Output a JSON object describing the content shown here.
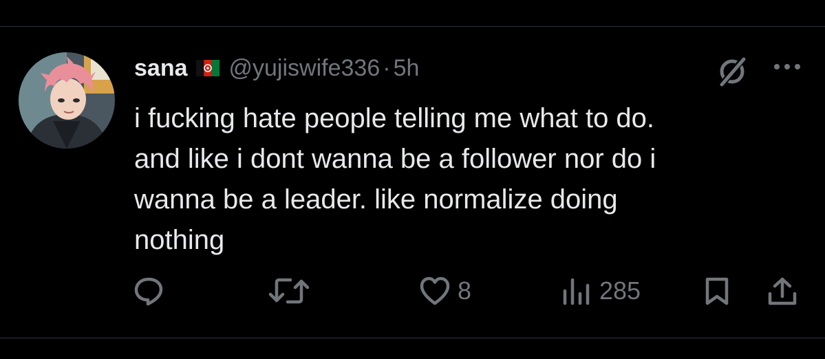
{
  "tweet": {
    "display_name": "sana",
    "handle": "@yujiswife336",
    "separator": "·",
    "time": "5h",
    "text": "i fucking hate people telling me what to do.\nand like i dont wanna be a follower nor do i\nwanna be a leader. like normalize doing\nnothing",
    "flag_icon": "afghanistan-flag-emoji",
    "avatar": "anime-character-pink-hair-avatar"
  },
  "actions": {
    "reply": {
      "icon": "reply-icon",
      "count": ""
    },
    "retweet": {
      "icon": "retweet-icon",
      "count": ""
    },
    "like": {
      "icon": "heart-icon",
      "count": "8"
    },
    "views": {
      "icon": "views-bar-chart-icon",
      "count": "285"
    },
    "bookmark": {
      "icon": "bookmark-icon"
    },
    "share": {
      "icon": "share-icon"
    }
  },
  "header_icons": {
    "grok": "grok-icon",
    "more": "more-dots-icon"
  },
  "colors": {
    "background": "#000000",
    "text_primary": "#e7e9ea",
    "text_secondary": "#71767b",
    "divider": "#2f3336"
  }
}
